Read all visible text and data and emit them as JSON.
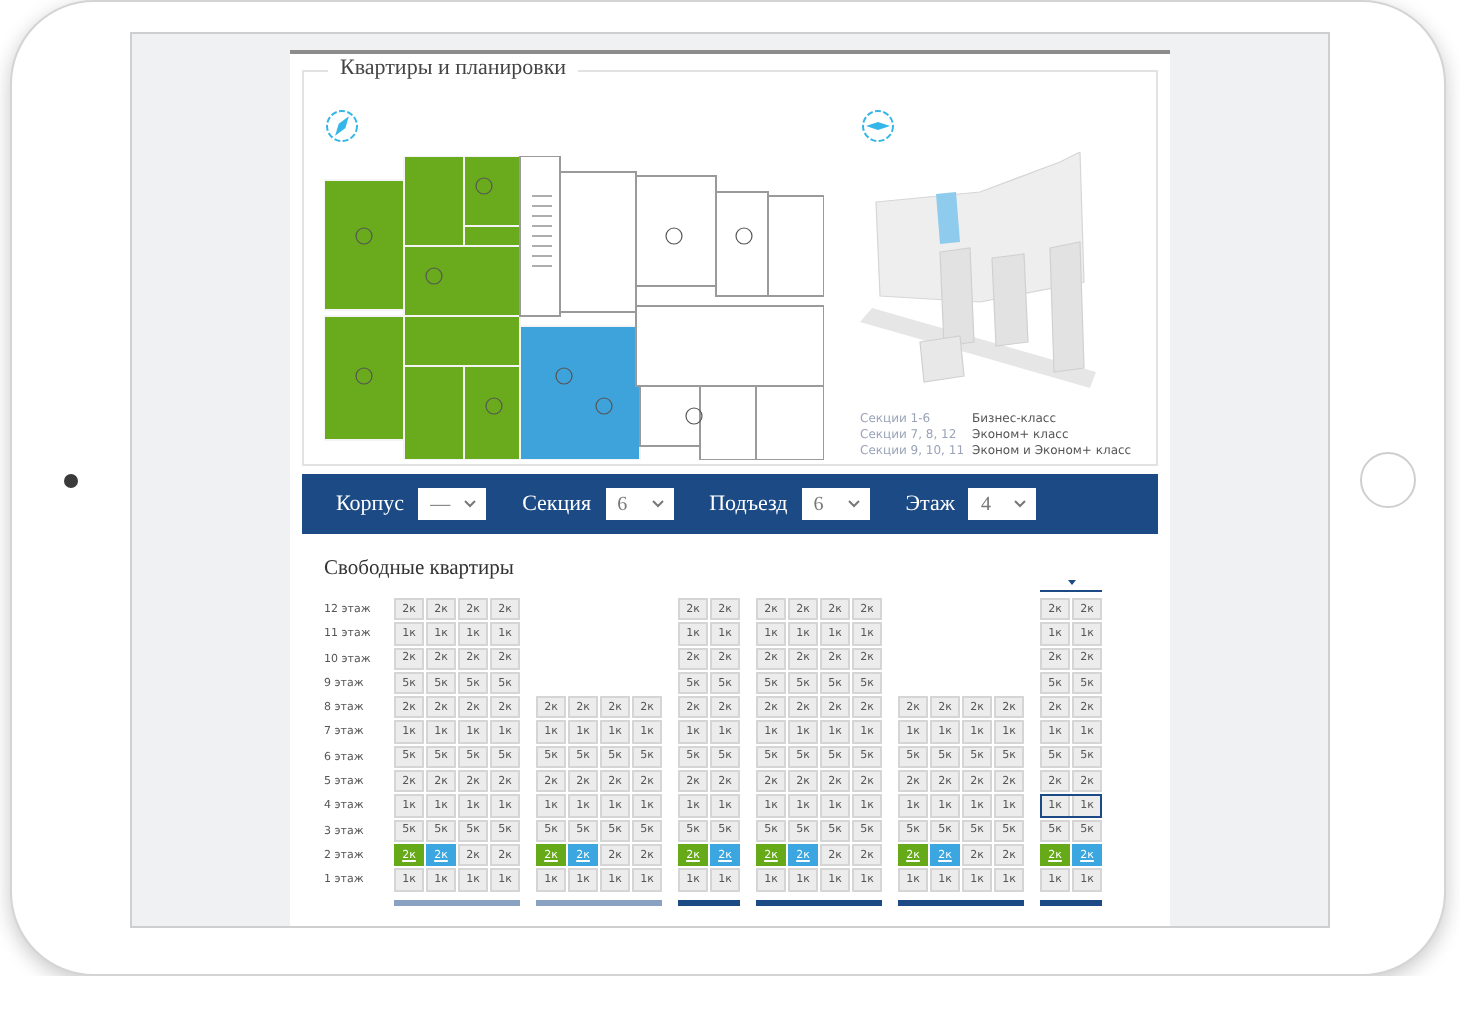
{
  "panel": {
    "title": "Квартиры и планировки"
  },
  "legend": [
    {
      "sections": "Секции 1-6",
      "class": "Бизнес-класс"
    },
    {
      "sections": "Секции 7, 8, 12",
      "class": "Эконом+ класс"
    },
    {
      "sections": "Секции 9, 10, 11",
      "class": "Эконом и Эконом+ класс"
    }
  ],
  "filters": [
    {
      "label": "Корпус",
      "value": "—"
    },
    {
      "label": "Секция",
      "value": "6"
    },
    {
      "label": "Подъезд",
      "value": "6"
    },
    {
      "label": "Этаж",
      "value": "4"
    }
  ],
  "availability": {
    "title": "Свободные квартиры",
    "floors": [
      "12 этаж",
      "11 этаж",
      "10 этаж",
      "9 этаж",
      "8 этаж",
      "7 этаж",
      "6 этаж",
      "5 этаж",
      "4 этаж",
      "3 этаж",
      "2 этаж",
      "1 этаж"
    ],
    "sections": [
      {
        "selected": false,
        "active": false,
        "rows": [
          {
            "selected": false,
            "cells": [
              {
                "label": "2к",
                "kind": "plain"
              },
              {
                "label": "2к",
                "kind": "plain"
              },
              {
                "label": "2к",
                "kind": "plain"
              },
              {
                "label": "2к",
                "kind": "plain"
              }
            ]
          },
          {
            "selected": false,
            "cells": [
              {
                "label": "1к",
                "kind": "plain"
              },
              {
                "label": "1к",
                "kind": "plain"
              },
              {
                "label": "1к",
                "kind": "plain"
              },
              {
                "label": "1к",
                "kind": "plain"
              }
            ]
          },
          {
            "selected": false,
            "cells": [
              {
                "label": "2к",
                "kind": "plain"
              },
              {
                "label": "2к",
                "kind": "plain"
              },
              {
                "label": "2к",
                "kind": "plain"
              },
              {
                "label": "2к",
                "kind": "plain"
              }
            ]
          },
          {
            "selected": false,
            "cells": [
              {
                "label": "5к",
                "kind": "plain"
              },
              {
                "label": "5к",
                "kind": "plain"
              },
              {
                "label": "5к",
                "kind": "plain"
              },
              {
                "label": "5к",
                "kind": "plain"
              }
            ]
          },
          {
            "selected": false,
            "cells": [
              {
                "label": "2к",
                "kind": "plain"
              },
              {
                "label": "2к",
                "kind": "plain"
              },
              {
                "label": "2к",
                "kind": "plain"
              },
              {
                "label": "2к",
                "kind": "plain"
              }
            ]
          },
          {
            "selected": false,
            "cells": [
              {
                "label": "1к",
                "kind": "plain"
              },
              {
                "label": "1к",
                "kind": "plain"
              },
              {
                "label": "1к",
                "kind": "plain"
              },
              {
                "label": "1к",
                "kind": "plain"
              }
            ]
          },
          {
            "selected": false,
            "cells": [
              {
                "label": "5к",
                "kind": "plain"
              },
              {
                "label": "5к",
                "kind": "plain"
              },
              {
                "label": "5к",
                "kind": "plain"
              },
              {
                "label": "5к",
                "kind": "plain"
              }
            ]
          },
          {
            "selected": false,
            "cells": [
              {
                "label": "2к",
                "kind": "plain"
              },
              {
                "label": "2к",
                "kind": "plain"
              },
              {
                "label": "2к",
                "kind": "plain"
              },
              {
                "label": "2к",
                "kind": "plain"
              }
            ]
          },
          {
            "selected": false,
            "cells": [
              {
                "label": "1к",
                "kind": "plain"
              },
              {
                "label": "1к",
                "kind": "plain"
              },
              {
                "label": "1к",
                "kind": "plain"
              },
              {
                "label": "1к",
                "kind": "plain"
              }
            ]
          },
          {
            "selected": false,
            "cells": [
              {
                "label": "5к",
                "kind": "plain"
              },
              {
                "label": "5к",
                "kind": "plain"
              },
              {
                "label": "5к",
                "kind": "plain"
              },
              {
                "label": "5к",
                "kind": "plain"
              }
            ]
          },
          {
            "selected": false,
            "cells": [
              {
                "label": "2к",
                "kind": "green"
              },
              {
                "label": "2к",
                "kind": "blue"
              },
              {
                "label": "2к",
                "kind": "plain"
              },
              {
                "label": "2к",
                "kind": "plain"
              }
            ]
          },
          {
            "selected": false,
            "cells": [
              {
                "label": "1к",
                "kind": "plain"
              },
              {
                "label": "1к",
                "kind": "plain"
              },
              {
                "label": "1к",
                "kind": "plain"
              },
              {
                "label": "1к",
                "kind": "plain"
              }
            ]
          }
        ]
      },
      {
        "selected": false,
        "active": false,
        "rows": [
          {
            "selected": false,
            "cells": [
              {
                "label": "2к",
                "kind": "plain"
              },
              {
                "label": "2к",
                "kind": "plain"
              },
              {
                "label": "2к",
                "kind": "plain"
              },
              {
                "label": "2к",
                "kind": "plain"
              }
            ]
          },
          {
            "selected": false,
            "cells": [
              {
                "label": "1к",
                "kind": "plain"
              },
              {
                "label": "1к",
                "kind": "plain"
              },
              {
                "label": "1к",
                "kind": "plain"
              },
              {
                "label": "1к",
                "kind": "plain"
              }
            ]
          },
          {
            "selected": false,
            "cells": [
              {
                "label": "5к",
                "kind": "plain"
              },
              {
                "label": "5к",
                "kind": "plain"
              },
              {
                "label": "5к",
                "kind": "plain"
              },
              {
                "label": "5к",
                "kind": "plain"
              }
            ]
          },
          {
            "selected": false,
            "cells": [
              {
                "label": "2к",
                "kind": "plain"
              },
              {
                "label": "2к",
                "kind": "plain"
              },
              {
                "label": "2к",
                "kind": "plain"
              },
              {
                "label": "2к",
                "kind": "plain"
              }
            ]
          },
          {
            "selected": false,
            "cells": [
              {
                "label": "1к",
                "kind": "plain"
              },
              {
                "label": "1к",
                "kind": "plain"
              },
              {
                "label": "1к",
                "kind": "plain"
              },
              {
                "label": "1к",
                "kind": "plain"
              }
            ]
          },
          {
            "selected": false,
            "cells": [
              {
                "label": "5к",
                "kind": "plain"
              },
              {
                "label": "5к",
                "kind": "plain"
              },
              {
                "label": "5к",
                "kind": "plain"
              },
              {
                "label": "5к",
                "kind": "plain"
              }
            ]
          },
          {
            "selected": false,
            "cells": [
              {
                "label": "2к",
                "kind": "green"
              },
              {
                "label": "2к",
                "kind": "blue"
              },
              {
                "label": "2к",
                "kind": "plain"
              },
              {
                "label": "2к",
                "kind": "plain"
              }
            ]
          },
          {
            "selected": false,
            "cells": [
              {
                "label": "1к",
                "kind": "plain"
              },
              {
                "label": "1к",
                "kind": "plain"
              },
              {
                "label": "1к",
                "kind": "plain"
              },
              {
                "label": "1к",
                "kind": "plain"
              }
            ]
          }
        ]
      },
      {
        "selected": false,
        "active": true,
        "rows": [
          {
            "selected": false,
            "cells": [
              {
                "label": "2к",
                "kind": "plain"
              },
              {
                "label": "2к",
                "kind": "plain"
              }
            ]
          },
          {
            "selected": false,
            "cells": [
              {
                "label": "1к",
                "kind": "plain"
              },
              {
                "label": "1к",
                "kind": "plain"
              }
            ]
          },
          {
            "selected": false,
            "cells": [
              {
                "label": "2к",
                "kind": "plain"
              },
              {
                "label": "2к",
                "kind": "plain"
              }
            ]
          },
          {
            "selected": false,
            "cells": [
              {
                "label": "5к",
                "kind": "plain"
              },
              {
                "label": "5к",
                "kind": "plain"
              }
            ]
          },
          {
            "selected": false,
            "cells": [
              {
                "label": "2к",
                "kind": "plain"
              },
              {
                "label": "2к",
                "kind": "plain"
              }
            ]
          },
          {
            "selected": false,
            "cells": [
              {
                "label": "1к",
                "kind": "plain"
              },
              {
                "label": "1к",
                "kind": "plain"
              }
            ]
          },
          {
            "selected": false,
            "cells": [
              {
                "label": "5к",
                "kind": "plain"
              },
              {
                "label": "5к",
                "kind": "plain"
              }
            ]
          },
          {
            "selected": false,
            "cells": [
              {
                "label": "2к",
                "kind": "plain"
              },
              {
                "label": "2к",
                "kind": "plain"
              }
            ]
          },
          {
            "selected": false,
            "cells": [
              {
                "label": "1к",
                "kind": "plain"
              },
              {
                "label": "1к",
                "kind": "plain"
              }
            ]
          },
          {
            "selected": false,
            "cells": [
              {
                "label": "5к",
                "kind": "plain"
              },
              {
                "label": "5к",
                "kind": "plain"
              }
            ]
          },
          {
            "selected": false,
            "cells": [
              {
                "label": "2к",
                "kind": "green"
              },
              {
                "label": "2к",
                "kind": "blue"
              }
            ]
          },
          {
            "selected": false,
            "cells": [
              {
                "label": "1к",
                "kind": "plain"
              },
              {
                "label": "1к",
                "kind": "plain"
              }
            ]
          }
        ]
      },
      {
        "selected": false,
        "active": true,
        "rows": [
          {
            "selected": false,
            "cells": [
              {
                "label": "2к",
                "kind": "plain"
              },
              {
                "label": "2к",
                "kind": "plain"
              },
              {
                "label": "2к",
                "kind": "plain"
              },
              {
                "label": "2к",
                "kind": "plain"
              }
            ]
          },
          {
            "selected": false,
            "cells": [
              {
                "label": "1к",
                "kind": "plain"
              },
              {
                "label": "1к",
                "kind": "plain"
              },
              {
                "label": "1к",
                "kind": "plain"
              },
              {
                "label": "1к",
                "kind": "plain"
              }
            ]
          },
          {
            "selected": false,
            "cells": [
              {
                "label": "2к",
                "kind": "plain"
              },
              {
                "label": "2к",
                "kind": "plain"
              },
              {
                "label": "2к",
                "kind": "plain"
              },
              {
                "label": "2к",
                "kind": "plain"
              }
            ]
          },
          {
            "selected": false,
            "cells": [
              {
                "label": "5к",
                "kind": "plain"
              },
              {
                "label": "5к",
                "kind": "plain"
              },
              {
                "label": "5к",
                "kind": "plain"
              },
              {
                "label": "5к",
                "kind": "plain"
              }
            ]
          },
          {
            "selected": false,
            "cells": [
              {
                "label": "2к",
                "kind": "plain"
              },
              {
                "label": "2к",
                "kind": "plain"
              },
              {
                "label": "2к",
                "kind": "plain"
              },
              {
                "label": "2к",
                "kind": "plain"
              }
            ]
          },
          {
            "selected": false,
            "cells": [
              {
                "label": "1к",
                "kind": "plain"
              },
              {
                "label": "1к",
                "kind": "plain"
              },
              {
                "label": "1к",
                "kind": "plain"
              },
              {
                "label": "1к",
                "kind": "plain"
              }
            ]
          },
          {
            "selected": false,
            "cells": [
              {
                "label": "5к",
                "kind": "plain"
              },
              {
                "label": "5к",
                "kind": "plain"
              },
              {
                "label": "5к",
                "kind": "plain"
              },
              {
                "label": "5к",
                "kind": "plain"
              }
            ]
          },
          {
            "selected": false,
            "cells": [
              {
                "label": "2к",
                "kind": "plain"
              },
              {
                "label": "2к",
                "kind": "plain"
              },
              {
                "label": "2к",
                "kind": "plain"
              },
              {
                "label": "2к",
                "kind": "plain"
              }
            ]
          },
          {
            "selected": false,
            "cells": [
              {
                "label": "1к",
                "kind": "plain"
              },
              {
                "label": "1к",
                "kind": "plain"
              },
              {
                "label": "1к",
                "kind": "plain"
              },
              {
                "label": "1к",
                "kind": "plain"
              }
            ]
          },
          {
            "selected": false,
            "cells": [
              {
                "label": "5к",
                "kind": "plain"
              },
              {
                "label": "5к",
                "kind": "plain"
              },
              {
                "label": "5к",
                "kind": "plain"
              },
              {
                "label": "5к",
                "kind": "plain"
              }
            ]
          },
          {
            "selected": false,
            "cells": [
              {
                "label": "2к",
                "kind": "green"
              },
              {
                "label": "2к",
                "kind": "blue"
              },
              {
                "label": "2к",
                "kind": "plain"
              },
              {
                "label": "2к",
                "kind": "plain"
              }
            ]
          },
          {
            "selected": false,
            "cells": [
              {
                "label": "1к",
                "kind": "plain"
              },
              {
                "label": "1к",
                "kind": "plain"
              },
              {
                "label": "1к",
                "kind": "plain"
              },
              {
                "label": "1к",
                "kind": "plain"
              }
            ]
          }
        ]
      },
      {
        "selected": false,
        "active": true,
        "rows": [
          {
            "selected": false,
            "cells": [
              {
                "label": "2к",
                "kind": "plain"
              },
              {
                "label": "2к",
                "kind": "plain"
              },
              {
                "label": "2к",
                "kind": "plain"
              },
              {
                "label": "2к",
                "kind": "plain"
              }
            ]
          },
          {
            "selected": false,
            "cells": [
              {
                "label": "1к",
                "kind": "plain"
              },
              {
                "label": "1к",
                "kind": "plain"
              },
              {
                "label": "1к",
                "kind": "plain"
              },
              {
                "label": "1к",
                "kind": "plain"
              }
            ]
          },
          {
            "selected": false,
            "cells": [
              {
                "label": "5к",
                "kind": "plain"
              },
              {
                "label": "5к",
                "kind": "plain"
              },
              {
                "label": "5к",
                "kind": "plain"
              },
              {
                "label": "5к",
                "kind": "plain"
              }
            ]
          },
          {
            "selected": false,
            "cells": [
              {
                "label": "2к",
                "kind": "plain"
              },
              {
                "label": "2к",
                "kind": "plain"
              },
              {
                "label": "2к",
                "kind": "plain"
              },
              {
                "label": "2к",
                "kind": "plain"
              }
            ]
          },
          {
            "selected": false,
            "cells": [
              {
                "label": "1к",
                "kind": "plain"
              },
              {
                "label": "1к",
                "kind": "plain"
              },
              {
                "label": "1к",
                "kind": "plain"
              },
              {
                "label": "1к",
                "kind": "plain"
              }
            ]
          },
          {
            "selected": false,
            "cells": [
              {
                "label": "5к",
                "kind": "plain"
              },
              {
                "label": "5к",
                "kind": "plain"
              },
              {
                "label": "5к",
                "kind": "plain"
              },
              {
                "label": "5к",
                "kind": "plain"
              }
            ]
          },
          {
            "selected": false,
            "cells": [
              {
                "label": "2к",
                "kind": "green"
              },
              {
                "label": "2к",
                "kind": "blue"
              },
              {
                "label": "2к",
                "kind": "plain"
              },
              {
                "label": "2к",
                "kind": "plain"
              }
            ]
          },
          {
            "selected": false,
            "cells": [
              {
                "label": "1к",
                "kind": "plain"
              },
              {
                "label": "1к",
                "kind": "plain"
              },
              {
                "label": "1к",
                "kind": "plain"
              },
              {
                "label": "1к",
                "kind": "plain"
              }
            ]
          }
        ]
      },
      {
        "selected": true,
        "active": true,
        "rows": [
          {
            "selected": false,
            "cells": [
              {
                "label": "2к",
                "kind": "plain"
              },
              {
                "label": "2к",
                "kind": "plain"
              }
            ]
          },
          {
            "selected": false,
            "cells": [
              {
                "label": "1к",
                "kind": "plain"
              },
              {
                "label": "1к",
                "kind": "plain"
              }
            ]
          },
          {
            "selected": false,
            "cells": [
              {
                "label": "2к",
                "kind": "plain"
              },
              {
                "label": "2к",
                "kind": "plain"
              }
            ]
          },
          {
            "selected": false,
            "cells": [
              {
                "label": "5к",
                "kind": "plain"
              },
              {
                "label": "5к",
                "kind": "plain"
              }
            ]
          },
          {
            "selected": false,
            "cells": [
              {
                "label": "2к",
                "kind": "plain"
              },
              {
                "label": "2к",
                "kind": "plain"
              }
            ]
          },
          {
            "selected": false,
            "cells": [
              {
                "label": "1к",
                "kind": "plain"
              },
              {
                "label": "1к",
                "kind": "plain"
              }
            ]
          },
          {
            "selected": false,
            "cells": [
              {
                "label": "5к",
                "kind": "plain"
              },
              {
                "label": "5к",
                "kind": "plain"
              }
            ]
          },
          {
            "selected": false,
            "cells": [
              {
                "label": "2к",
                "kind": "plain"
              },
              {
                "label": "2к",
                "kind": "plain"
              }
            ]
          },
          {
            "selected": true,
            "cells": [
              {
                "label": "1к",
                "kind": "plain"
              },
              {
                "label": "1к",
                "kind": "plain"
              }
            ]
          },
          {
            "selected": false,
            "cells": [
              {
                "label": "5к",
                "kind": "plain"
              },
              {
                "label": "5к",
                "kind": "plain"
              }
            ]
          },
          {
            "selected": false,
            "cells": [
              {
                "label": "2к",
                "kind": "green"
              },
              {
                "label": "2к",
                "kind": "blue"
              }
            ]
          },
          {
            "selected": false,
            "cells": [
              {
                "label": "1к",
                "kind": "plain"
              },
              {
                "label": "1к",
                "kind": "plain"
              }
            ]
          }
        ]
      }
    ]
  }
}
